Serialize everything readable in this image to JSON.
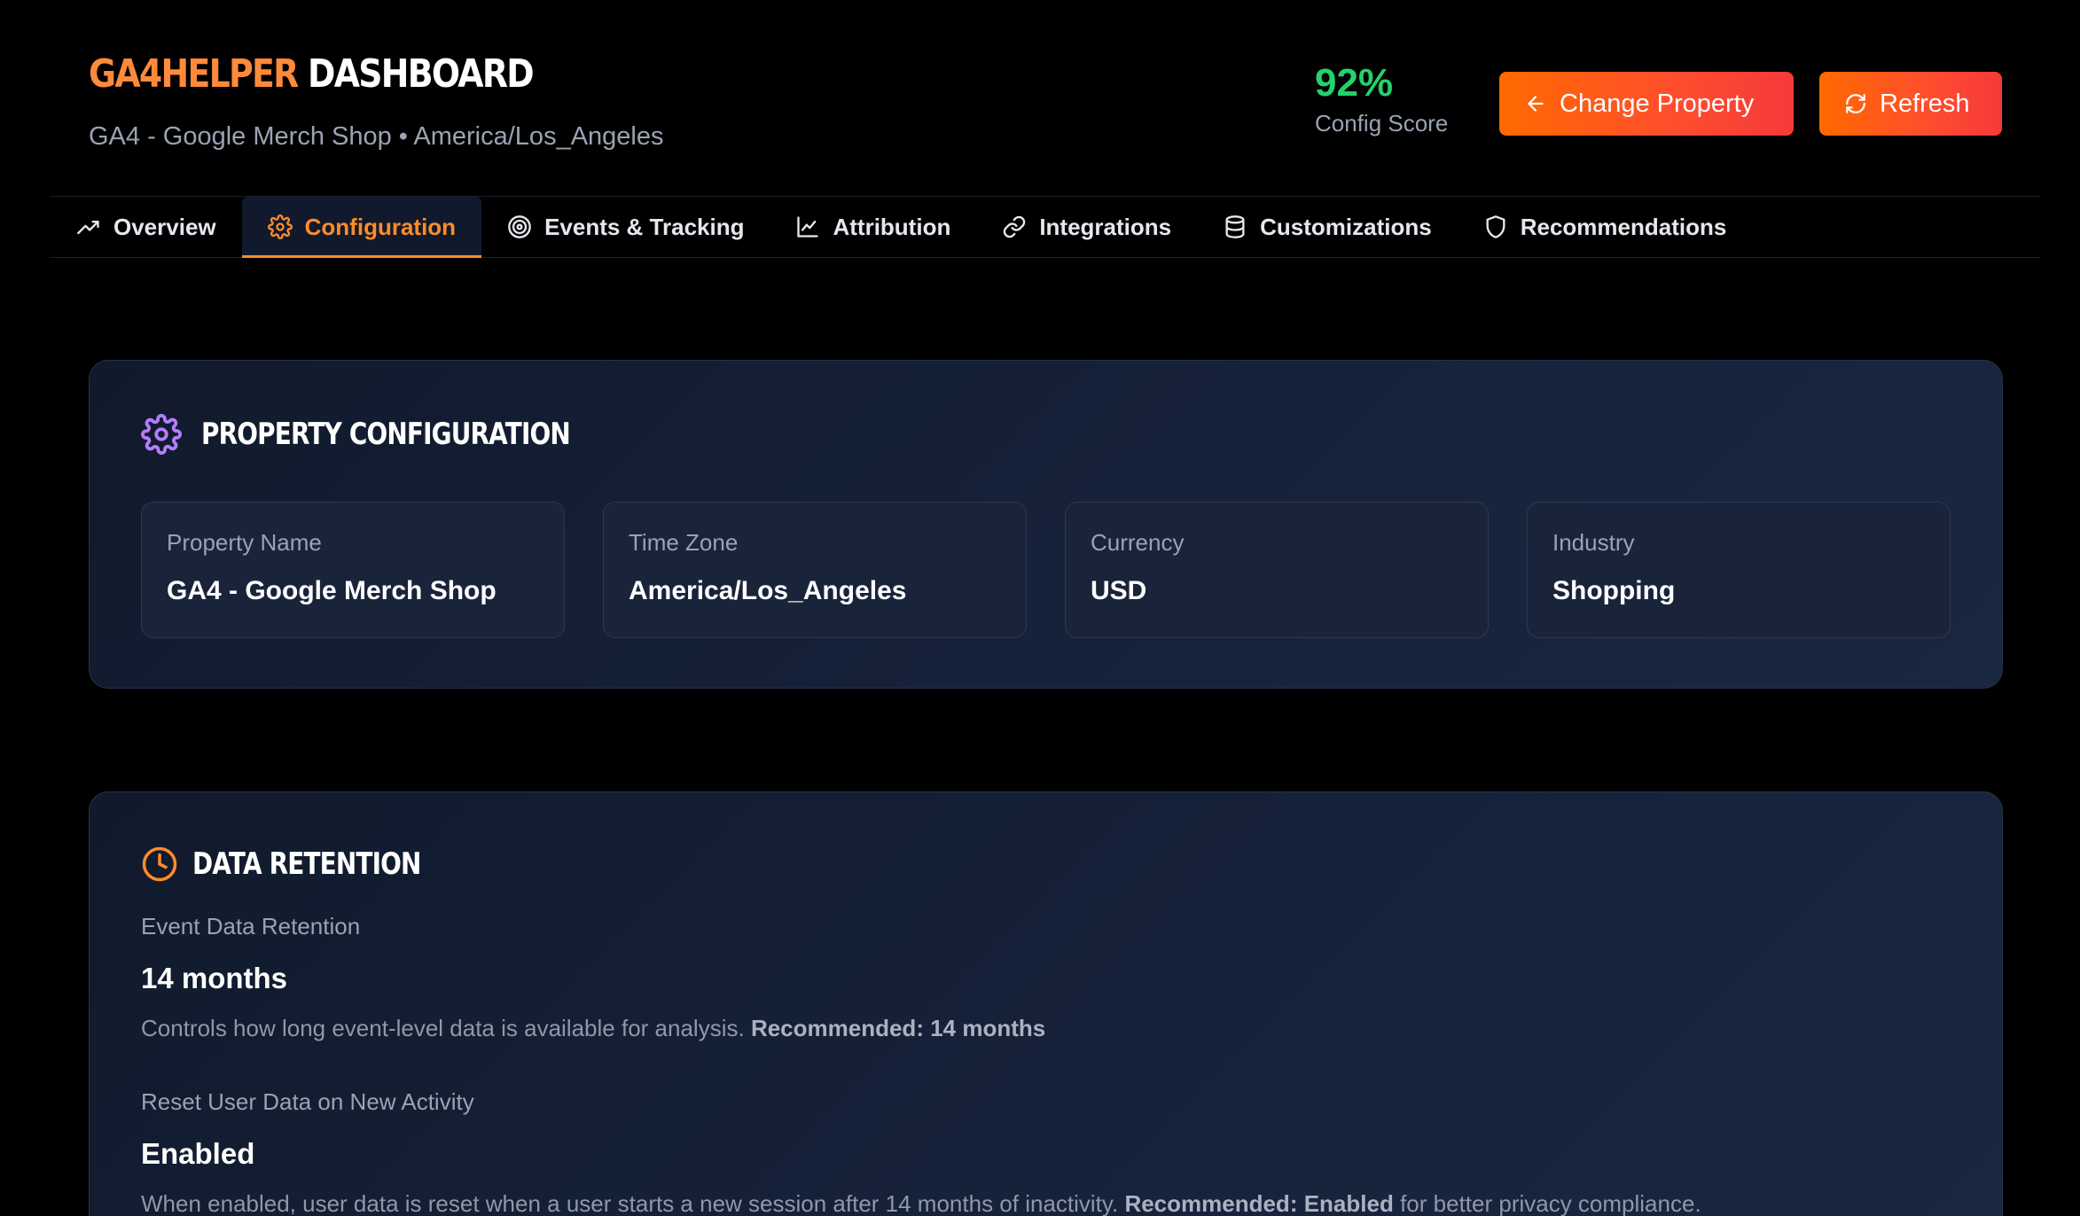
{
  "header": {
    "brand_accent": "GA4HELPER",
    "brand_rest": "DASHBOARD",
    "subtitle": "GA4 - Google Merch Shop • America/Los_Angeles",
    "score_value": "92%",
    "score_label": "Config Score",
    "change_property_label": "Change Property",
    "refresh_label": "Refresh"
  },
  "tabs": [
    {
      "label": "Overview",
      "icon": "trending-up-icon"
    },
    {
      "label": "Configuration",
      "icon": "gear-icon",
      "active": true
    },
    {
      "label": "Events & Tracking",
      "icon": "target-icon"
    },
    {
      "label": "Attribution",
      "icon": "line-chart-icon"
    },
    {
      "label": "Integrations",
      "icon": "link-icon"
    },
    {
      "label": "Customizations",
      "icon": "database-icon"
    },
    {
      "label": "Recommendations",
      "icon": "shield-icon"
    }
  ],
  "property_config": {
    "title": "PROPERTY CONFIGURATION",
    "fields": [
      {
        "label": "Property Name",
        "value": "GA4 - Google Merch Shop"
      },
      {
        "label": "Time Zone",
        "value": "America/Los_Angeles"
      },
      {
        "label": "Currency",
        "value": "USD"
      },
      {
        "label": "Industry",
        "value": "Shopping"
      }
    ]
  },
  "data_retention": {
    "title": "DATA RETENTION",
    "event_label": "Event Data Retention",
    "event_value": "14 months",
    "event_desc": "Controls how long event-level data is available for analysis.",
    "event_rec": "Recommended: 14 months",
    "reset_label": "Reset User Data on New Activity",
    "reset_value": "Enabled",
    "reset_desc": "When enabled, user data is reset when a user starts a new session after 14 months of inactivity.",
    "reset_rec": "Recommended: Enabled",
    "reset_desc_tail": "for better privacy compliance."
  },
  "colors": {
    "accent_orange": "#ff8c2a",
    "score_green": "#22d36b",
    "gear_purple": "#b57cff"
  }
}
